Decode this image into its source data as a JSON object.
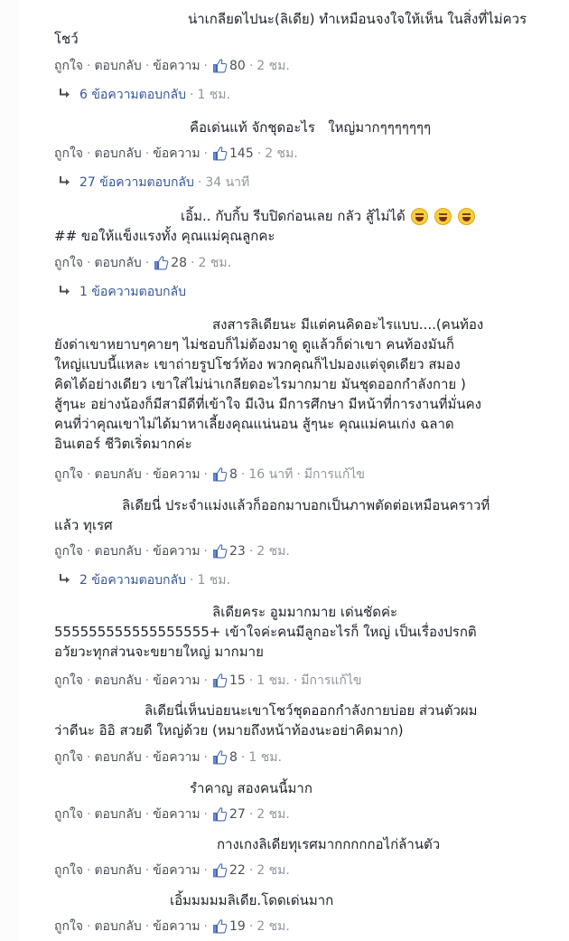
{
  "actions": {
    "like": "ถูกใจ",
    "reply": "ตอบกลับ",
    "message": "ข้อความ",
    "sep": "·"
  },
  "comments": [
    {
      "text": "น่าเกลียดไปนะ(ลิเดีย) ทำเหมือนจงใจให้เห็น ในสิ่งที่ไม่ควร\nโชว์",
      "has_message": true,
      "likes": "80",
      "time": "2 ชม.",
      "edited": "",
      "replies": "6 ข้อความตอบกลับ",
      "reply_time": "1 ชม."
    },
    {
      "text": "คือเด่นแท้ จักชุดอะไร   ใหญ่มากๆๆๆๆๆๆๆ",
      "has_message": true,
      "likes": "145",
      "time": "2 ชม.",
      "edited": "",
      "replies": "27 ข้อความตอบกลับ",
      "reply_time": "34 นาที"
    },
    {
      "text": "เอิ้ม.. กับกิ้บ รีบปิดก่อนเลย กลัว สู้ไม่ได้\n## ขอให้แข็งแรงทั้ง คุณแม่คุณลูกคะ",
      "has_message": false,
      "emoji": [
        "laughing-emoji",
        "laughing-emoji",
        "laughing-emoji"
      ],
      "likes": "28",
      "time": "2 ชม.",
      "edited": "",
      "replies": "1 ข้อความตอบกลับ",
      "reply_time": ""
    },
    {
      "text": "สงสารลิเดียนะ มีแต่คนคิดอะไรแบบ....(คนท้อง\nยังด่าเขาหยาบๆคายๆ ไม่ชอบก็ไม่ต้องมาดู ดูแล้วก็ด่าเขา คนท้องมันก็\nใหญ่แบบนี้แหละ เขาถ่ายรูปโชว์ท้อง พวกคุณก็ไปมองแต่จุดเดียว สมอง\nคิดได้อย่างเดียว เขาใส่ไม่น่าเกลียดอะไรมากมาย มันชุดออกกำลังกาย )\nสู้ๆนะ อย่างน้องก็มีสามีดีที่เข้าใจ มีเงิน มีการศึกษา มีหน้าที่การงานที่มั่นคง\nคนที่ว่าคุณเขาไม่ได้มาหาเลี้ยงคุณแน่นอน สู้ๆนะ คุณแม่คนเก่ง ฉลาด\nอินเตอร์ ชีวิตเริ่ดมากค่ะ",
      "has_message": true,
      "likes": "8",
      "time": "16 นาที",
      "edited": "มีการแก้ไข",
      "replies": "",
      "reply_time": ""
    },
    {
      "text": "ลิเดียนี่ ประจำแม่งแล้วก็ออกมาบอกเป็นภาพตัดต่อเหมือนคราวที่\nแล้ว ทุเรศ",
      "has_message": true,
      "likes": "23",
      "time": "2 ชม.",
      "edited": "",
      "replies": "2 ข้อความตอบกลับ",
      "reply_time": "1 ชม."
    },
    {
      "text": "ลิเดียคระ อูมมากมาย เด่นชัดค่ะ\n555555555555555555+ เข้าใจค่ะคนมีลูกอะไรก็ ใหญ่ เป็นเรื่องปรกติ\nอวัยวะทุกส่วนจะขยายใหญ่ มากมาย",
      "has_message": true,
      "likes": "15",
      "time": "1 ชม.",
      "edited": "มีการแก้ไข",
      "replies": "",
      "reply_time": ""
    },
    {
      "text": "ลิเดียนี่เห็นบ่อยนะเขาโชว์ชุดออกกำลังกายบ่อย ส่วนตัวผม\nว่าดีนะ อิอิ สวยดี ใหญ่ด้วย (หมายถึงหน้าท้องนะอย่าคิดมาก)",
      "has_message": true,
      "likes": "8",
      "time": "1 ชม.",
      "edited": "",
      "replies": "",
      "reply_time": ""
    },
    {
      "text": "รำคาญ สองคนนี้มาก",
      "has_message": true,
      "likes": "27",
      "time": "2 ชม.",
      "edited": "",
      "replies": "",
      "reply_time": ""
    },
    {
      "text": "กางเกงลิเดียทุเรศมากกกกกอไก่ล้านตัว",
      "has_message": true,
      "likes": "22",
      "time": "2 ชม.",
      "edited": "",
      "replies": "",
      "reply_time": ""
    },
    {
      "text": "เอิ้มมมมมลิเดีย.โดดเด่นมาก",
      "has_message": true,
      "likes": "19",
      "time": "2 ชม.",
      "edited": "",
      "replies": "",
      "reply_time": ""
    }
  ]
}
